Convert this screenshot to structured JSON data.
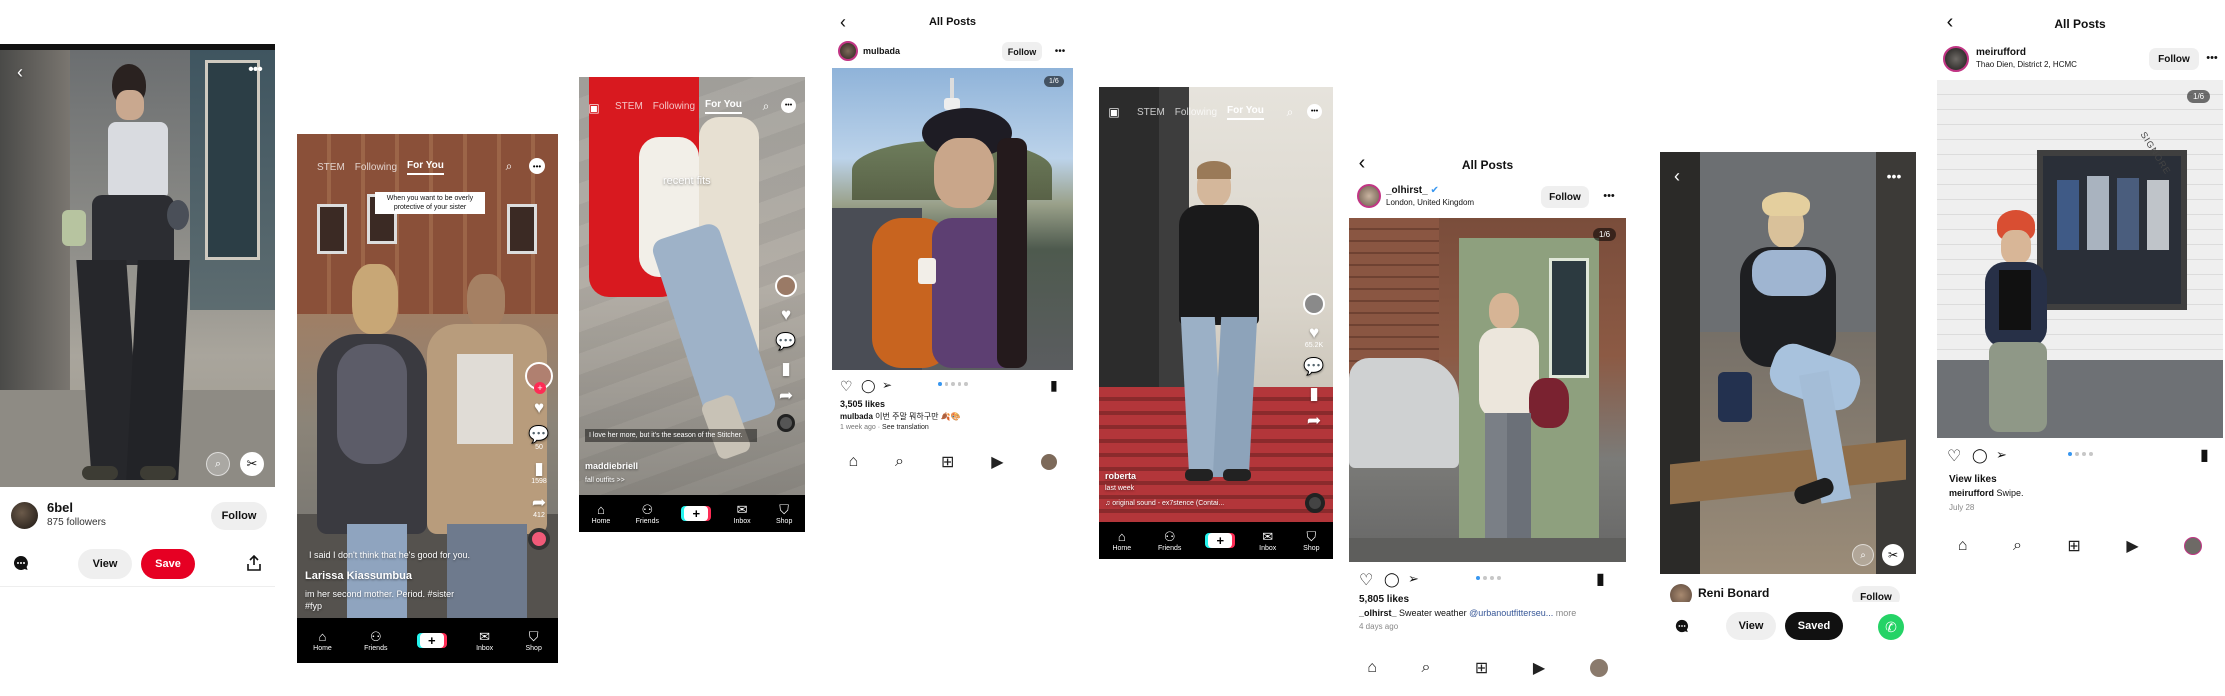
{
  "pin1": {
    "author": "6bel",
    "followers": "875 followers",
    "follow_label": "Follow",
    "view_label": "View",
    "save_label": "Save",
    "back_icon": "chevron-left-icon",
    "more_icon": "more-icon"
  },
  "tt1": {
    "tabs": [
      "STEM",
      "Following",
      "For You"
    ],
    "sticker": "When you want to be overly protective of your sister",
    "caption_top": "I said I don't think that he's good for you.",
    "author": "Larissa Kiassumbua",
    "caption": "im her second mother. Period. #sister",
    "hashtag": "#fyp",
    "likes": "",
    "comments": "50",
    "saves": "1598",
    "shares": "412",
    "nav": [
      "Home",
      "Friends",
      "",
      "Inbox",
      "Shop"
    ]
  },
  "tt2": {
    "tabs": [
      "STEM",
      "Following",
      "For You"
    ],
    "overlay": "recent fits",
    "caption": "I love her more, but it's the season of the Stitcher.",
    "author": "maddiebriell",
    "sub": "fall outfits >>",
    "nav": [
      "Home",
      "Friends",
      "",
      "Inbox",
      "Shop"
    ]
  },
  "ig1": {
    "header": "All Posts",
    "username": "mulbada",
    "follow_label": "Follow",
    "counter": "1/6",
    "likes": "3,505 likes",
    "caption_user": "mulbada",
    "caption": "이번 주말 뭐하구만 🍂🎨",
    "time": "1 week ago",
    "see_translation": "See translation"
  },
  "tt3": {
    "tabs": [
      "STEM",
      "Following",
      "For You"
    ],
    "author": "roberta",
    "time": "last week",
    "sound": "♫ original sound - ex7stence (Contai...",
    "likes": "65.2K",
    "nav": [
      "Home",
      "Friends",
      "",
      "Inbox",
      "Shop"
    ]
  },
  "ig2": {
    "header": "All Posts",
    "username": "_olhirst_",
    "location": "London, United Kingdom",
    "follow_label": "Follow",
    "counter": "1/6",
    "likes": "5,805 likes",
    "caption_user": "_olhirst_",
    "caption": "Sweater weather",
    "mention": "@urbanoutfitterseu...",
    "more": "more",
    "time": "4 days ago"
  },
  "pin2": {
    "author": "Reni Bonard",
    "follow_label": "Follow",
    "view_label": "View",
    "saved_label": "Saved"
  },
  "ig3": {
    "header": "All Posts",
    "username": "meirufford",
    "location": "Thao Dien, District 2, HCMC",
    "follow_label": "Follow",
    "counter": "1/6",
    "view_likes": "View likes",
    "caption_user": "meirufford",
    "caption": "Swipe.",
    "time": "July 28",
    "sign": "SIGNORE"
  },
  "colors": {
    "save_red": "#e60023",
    "tiktok_cyan": "#25f4ee",
    "tiktok_pink": "#fe2c55",
    "ig_blue": "#3897f0",
    "whatsapp_green": "#25d366"
  }
}
